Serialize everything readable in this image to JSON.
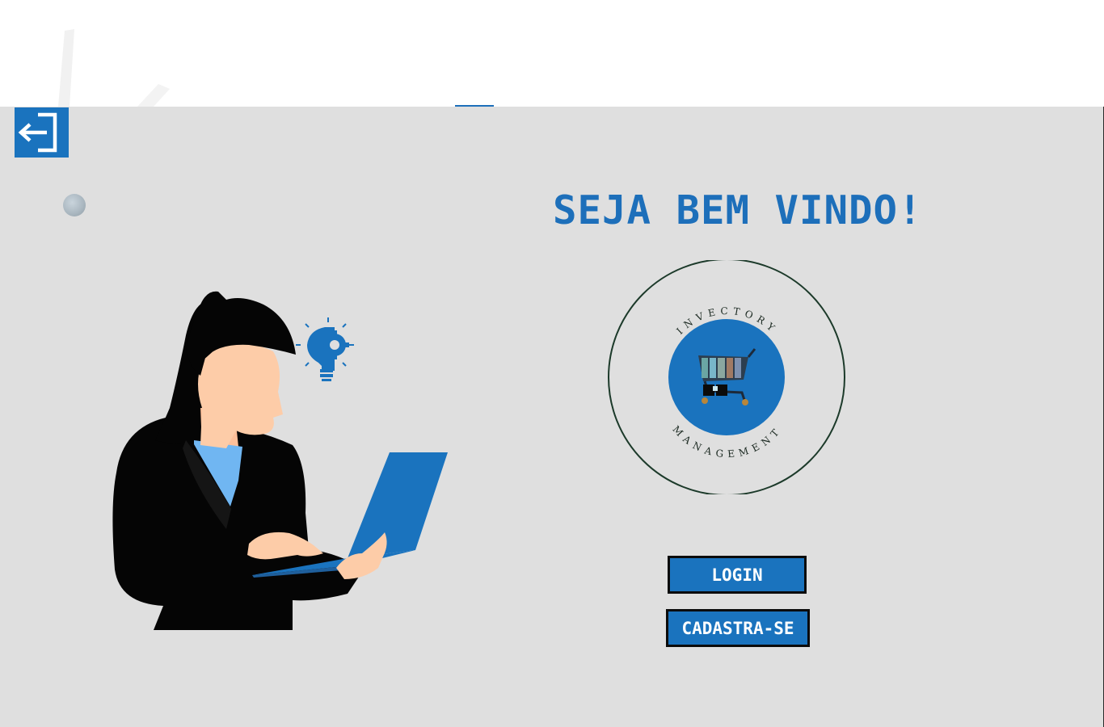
{
  "header": {
    "exit_icon": "exit-icon"
  },
  "main": {
    "headline": "SEJA BEM VINDO!",
    "logo": {
      "top_text": "INVECTORY",
      "bottom_text": "MANAGEMENT",
      "icon": "shopping-cart-icon"
    },
    "illustration": {
      "icon": "lightbulb-gear-icon"
    }
  },
  "actions": {
    "login_label": "LOGIN",
    "signup_label": "CADASTRA-SE"
  },
  "colors": {
    "accent": "#1d6fba",
    "button": "#1a73be",
    "background": "#dfdfdf",
    "logo_ring": "#1c3a2a"
  }
}
